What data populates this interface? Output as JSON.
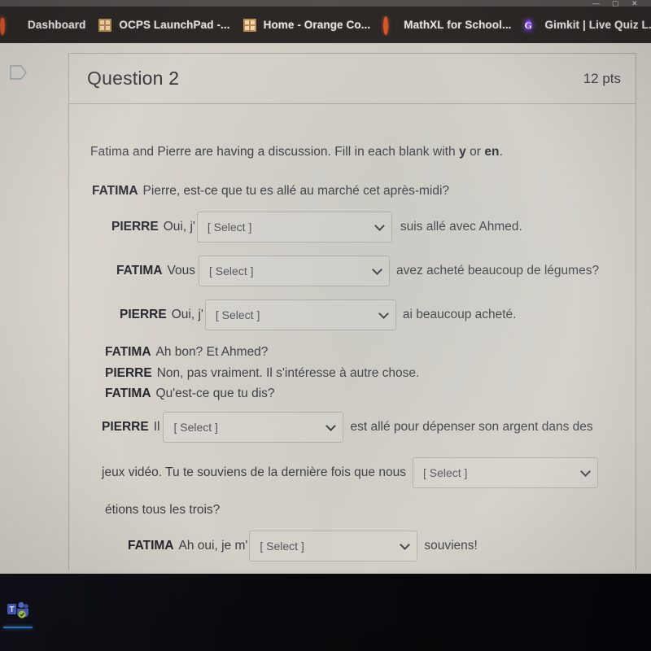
{
  "window": {
    "minimize_label": "—",
    "maximize_label": "▢",
    "close_label": "✕"
  },
  "bookmarks_bar": {
    "items": [
      {
        "label": "Dashboard",
        "icon": "canvas-ring-icon"
      },
      {
        "label": "OCPS LaunchPad -...",
        "icon": "ocps-grid-icon"
      },
      {
        "label": "Home - Orange Co...",
        "icon": "ocps-grid-icon"
      },
      {
        "label": "MathXL for School...",
        "icon": "mathxl-ring-icon"
      },
      {
        "label": "Gimkit | Live Quiz L...",
        "icon": "gimkit-g-icon",
        "icon_letter": "G"
      }
    ]
  },
  "question": {
    "flag_icon": "flag-outline-icon",
    "title": "Question 2",
    "points": "12 pts",
    "instructions_prefix": "Fatima and Pierre are having a discussion. Fill in each blank with ",
    "instructions_bold_1": "y",
    "instructions_mid": " or ",
    "instructions_bold_2": "en",
    "instructions_suffix": ".",
    "select_placeholder": "[ Select ]",
    "chevron_icon": "chevron-down-icon",
    "lines": [
      {
        "speaker": "FATIMA",
        "before": "Pierre, est-ce que tu es allé au marché cet après-midi?",
        "has_select": false
      },
      {
        "speaker": "PIERRE",
        "before": "Oui, j'",
        "has_select": true,
        "after": "suis allé avec Ahmed."
      },
      {
        "speaker": "FATIMA",
        "before": "Vous",
        "has_select": true,
        "after": "avez acheté beaucoup de légumes?"
      },
      {
        "speaker": "PIERRE",
        "before": "Oui, j'",
        "has_select": true,
        "after": "ai beaucoup acheté."
      },
      {
        "speaker": "FATIMA",
        "before": "Ah bon? Et Ahmed?",
        "has_select": false
      },
      {
        "speaker": "PIERRE",
        "before": "Non, pas vraiment. Il s'intéresse à autre chose.",
        "has_select": false
      },
      {
        "speaker": "FATIMA",
        "before": "Qu'est-ce que tu dis?",
        "has_select": false
      },
      {
        "speaker": "PIERRE",
        "before": "Il",
        "has_select": true,
        "after": "est allé pour dépenser son argent dans des"
      },
      {
        "speaker": "",
        "before": "jeux vidéo. Tu te souviens de la dernière fois que nous",
        "has_select": true,
        "after": ""
      },
      {
        "speaker": "",
        "before": "étions tous les trois?",
        "has_select": false
      },
      {
        "speaker": "FATIMA",
        "before": "Ah oui, je m'",
        "has_select": true,
        "after": "souviens!"
      }
    ]
  },
  "taskbar": {
    "items": [
      {
        "label": "Microsoft Teams",
        "icon": "teams-icon",
        "active": true
      }
    ]
  },
  "colors": {
    "bookmark_bar_bg": "#2c2826",
    "page_bg": "#d3cfc6",
    "taskbar_bg": "#08080d",
    "accent_orange": "#d8562a",
    "accent_purple": "#6a33d8",
    "teams_blue": "#2f7fd0"
  }
}
